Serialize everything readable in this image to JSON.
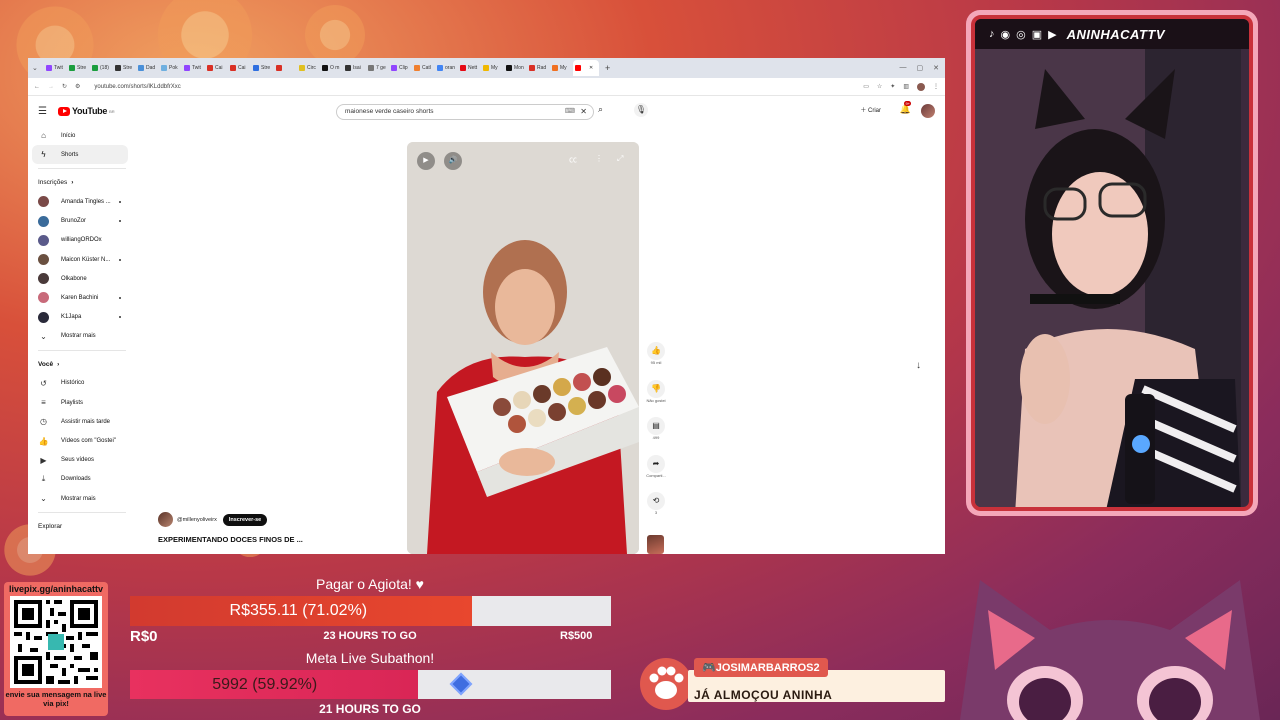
{
  "colors": {
    "accent": "#ff0000",
    "goal_fill": "#e8472e",
    "sub_fill": "#e8315f",
    "cam_border": "#c8313a"
  },
  "browser": {
    "tabs": [
      {
        "label": "Twit",
        "color": "#9146ff"
      },
      {
        "label": "Stre",
        "color": "#1b9e3e"
      },
      {
        "label": "(18)",
        "color": "#1b9e3e"
      },
      {
        "label": "Stre",
        "color": "#333333"
      },
      {
        "label": "Dad",
        "color": "#4a90d9"
      },
      {
        "label": "Pok",
        "color": "#6fb0e0"
      },
      {
        "label": "Twit",
        "color": "#9146ff"
      },
      {
        "label": "Cai",
        "color": "#d93025"
      },
      {
        "label": "Cai",
        "color": "#d93025"
      },
      {
        "label": "Stre",
        "color": "#2f6fe0"
      },
      {
        "label": "",
        "color": "#d93025"
      },
      {
        "label": "Circ",
        "color": "#e0c020"
      },
      {
        "label": "O m",
        "color": "#111111"
      },
      {
        "label": "Isai",
        "color": "#333333"
      },
      {
        "label": "7 ge",
        "color": "#777777"
      },
      {
        "label": "Clip",
        "color": "#9146ff"
      },
      {
        "label": "Catl",
        "color": "#f08030"
      },
      {
        "label": "oran",
        "color": "#4285f4"
      },
      {
        "label": "Nett",
        "color": "#e50914"
      },
      {
        "label": "My",
        "color": "#f0b800"
      },
      {
        "label": "Mon",
        "color": "#111111"
      },
      {
        "label": "Rad",
        "color": "#d93025"
      },
      {
        "label": "My",
        "color": "#f07020"
      },
      {
        "label": "",
        "color": "#ff0000"
      }
    ],
    "tab_close": "✕",
    "tab_new": "+",
    "url": "youtube.com/shorts/lKLddbfrXxc"
  },
  "youtube": {
    "logo_text": "YouTube",
    "logo_country": "BR",
    "search_value": "maionese verde caseiro shorts",
    "create_label": "Criar",
    "bell_badge": "9+",
    "sidebar": {
      "main": [
        {
          "label": "Início",
          "icon": "⌂"
        },
        {
          "label": "Shorts",
          "icon": "▶"
        }
      ],
      "subs_title": "Inscrições",
      "channels": [
        {
          "label": "Amanda Tingles ...",
          "color": "#7a4a48"
        },
        {
          "label": "BrunoZor",
          "color": "#3a6b9a"
        },
        {
          "label": "williangORDOx",
          "color": "#5a5a8a"
        },
        {
          "label": "Maicon Küster N...",
          "color": "#6a5040"
        },
        {
          "label": "Olkabone",
          "color": "#4a3a3a"
        },
        {
          "label": "Karen Bachini",
          "color": "#c86a7a"
        },
        {
          "label": "K1Japa",
          "color": "#2a2a3a"
        }
      ],
      "show_more": "Mostrar mais",
      "you_title": "Você",
      "you_items": [
        {
          "label": "Histórico",
          "icon": "↺"
        },
        {
          "label": "Playlists",
          "icon": "≡"
        },
        {
          "label": "Assistir mais tarde",
          "icon": "◷"
        },
        {
          "label": "Vídeos com \"Gostei\"",
          "icon": "👍"
        },
        {
          "label": "Seus vídeos",
          "icon": "▶"
        },
        {
          "label": "Downloads",
          "icon": "⤓"
        }
      ],
      "show_more_2": "Mostrar mais",
      "explore": "Explorar"
    },
    "short": {
      "channel": "@millenyoliveirx",
      "subscribe": "Inscrever-se",
      "title": "EXPERIMENTANDO DOCES FINOS DE ...",
      "like_count": "95 mil",
      "dislike_label": "Não gostei",
      "comments_count": "499",
      "share_label": "Comparti...",
      "remix_count": "3"
    }
  },
  "stream": {
    "handle": "ANINHACATTV",
    "goal_title": "Pagar o Agiota! ♥",
    "goal_amount": "R$355.11 (71.02%)",
    "goal_progress": 0.7102,
    "goal_min": "R$0",
    "goal_max": "R$500",
    "goal_time": "23 HOURS TO GO",
    "sub_title": "Meta Live Subathon!",
    "sub_amount": "5992 (59.92%)",
    "sub_progress": 0.5992,
    "sub_time": "21 HOURS TO GO",
    "qr_top": "livepix.gg/aninhacattv",
    "qr_bottom": "envie sua mensagem na live via pix!",
    "alert_user": "🎮JOSIMARBARROS2",
    "alert_message": "JÁ ALMOÇOU ANINHA"
  }
}
